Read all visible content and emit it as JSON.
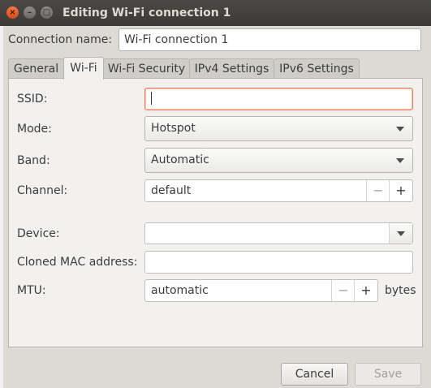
{
  "window": {
    "title": "Editing Wi-Fi connection 1",
    "close_glyph": "×",
    "minimize_glyph": "–",
    "maximize_glyph": "□"
  },
  "connection": {
    "label": "Connection name:",
    "value": "Wi-Fi connection 1"
  },
  "tabs": [
    {
      "label": "General",
      "active": false
    },
    {
      "label": "Wi-Fi",
      "active": true
    },
    {
      "label": "Wi-Fi Security",
      "active": false
    },
    {
      "label": "IPv4 Settings",
      "active": false
    },
    {
      "label": "IPv6 Settings",
      "active": false
    }
  ],
  "wifi": {
    "ssid": {
      "label": "SSID:",
      "value": ""
    },
    "mode": {
      "label": "Mode:",
      "value": "Hotspot"
    },
    "band": {
      "label": "Band:",
      "value": "Automatic"
    },
    "channel": {
      "label": "Channel:",
      "value": "default",
      "minus": "−",
      "plus": "+"
    },
    "device": {
      "label": "Device:",
      "value": ""
    },
    "cloned_mac": {
      "label": "Cloned MAC address:",
      "value": ""
    },
    "mtu": {
      "label": "MTU:",
      "value": "automatic",
      "minus": "−",
      "plus": "+",
      "unit": "bytes"
    }
  },
  "buttons": {
    "cancel": "Cancel",
    "save": "Save",
    "save_enabled": false
  },
  "colors": {
    "accent_focus": "#e9825c",
    "titlebar": "#3b3a36",
    "close_button": "#dd4814"
  }
}
